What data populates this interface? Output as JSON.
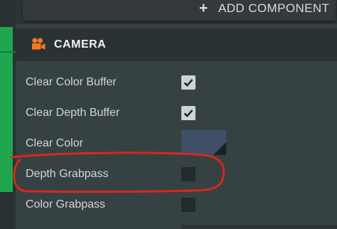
{
  "toolbar": {
    "add_component_label": "ADD COMPONENT",
    "add_icon": "plus-icon"
  },
  "section": {
    "title": "CAMERA",
    "icon": "camera-icon",
    "icon_color": "#f47a20"
  },
  "properties": [
    {
      "label": "Clear Color Buffer",
      "type": "checkbox",
      "checked": true
    },
    {
      "label": "Clear Depth Buffer",
      "type": "checkbox",
      "checked": true
    },
    {
      "label": "Clear Color",
      "type": "color",
      "value": "#3f5068"
    },
    {
      "label": "Depth Grabpass",
      "type": "checkbox",
      "checked": false
    },
    {
      "label": "Color Grabpass",
      "type": "checkbox",
      "checked": false
    }
  ],
  "colors": {
    "accent_green": "#1fa64e",
    "highlight_annotation": "#d8281c"
  }
}
